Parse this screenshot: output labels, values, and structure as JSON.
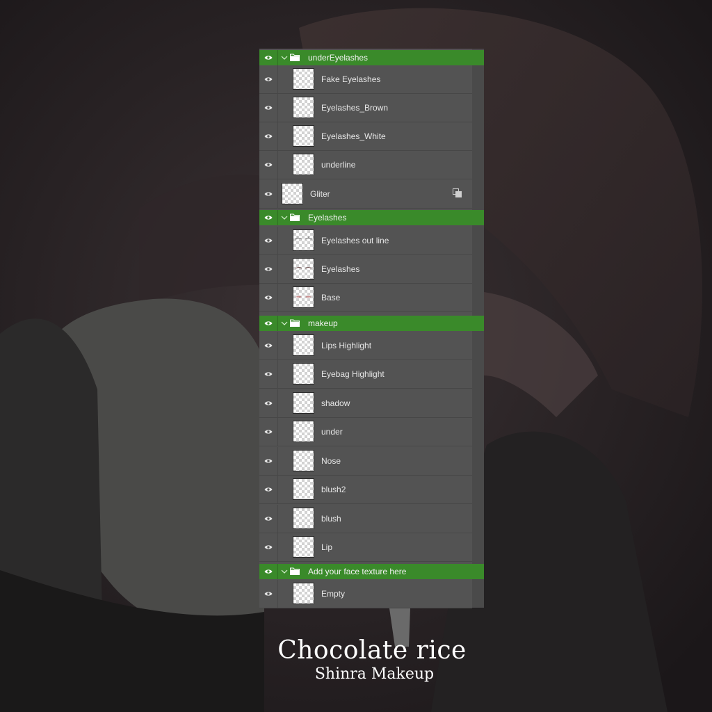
{
  "colors": {
    "panel_bg": "#535353",
    "group_row": "#3a8a2a",
    "text": "#e6e6e6",
    "background": "#1e1a1c"
  },
  "layers": {
    "group_underEyelashes": {
      "name": "underEyelashes",
      "children": [
        "Fake Eyelashes",
        "Eyelashes_Brown",
        "Eyelashes_White",
        "underline"
      ]
    },
    "layer_gliter": {
      "name": "Gliter",
      "badge_icon": "smart-object-icon"
    },
    "group_eyelashes": {
      "name": "Eyelashes",
      "children": [
        "Eyelashes out line",
        "Eyelashes",
        "Base"
      ]
    },
    "group_makeup": {
      "name": "makeup",
      "children": [
        "Lips Highlight",
        "Eyebag Highlight",
        "shadow",
        "under",
        "Nose",
        "blush2",
        "blush",
        "Lip"
      ]
    },
    "group_face_texture": {
      "name": "Add your face texture here",
      "children": [
        "Empty"
      ]
    }
  },
  "icons": {
    "visibility": "eye-icon",
    "expand": "chevron-down-icon",
    "group": "folder-icon"
  },
  "title": "Chocolate rice",
  "subtitle": "Shinra Makeup"
}
